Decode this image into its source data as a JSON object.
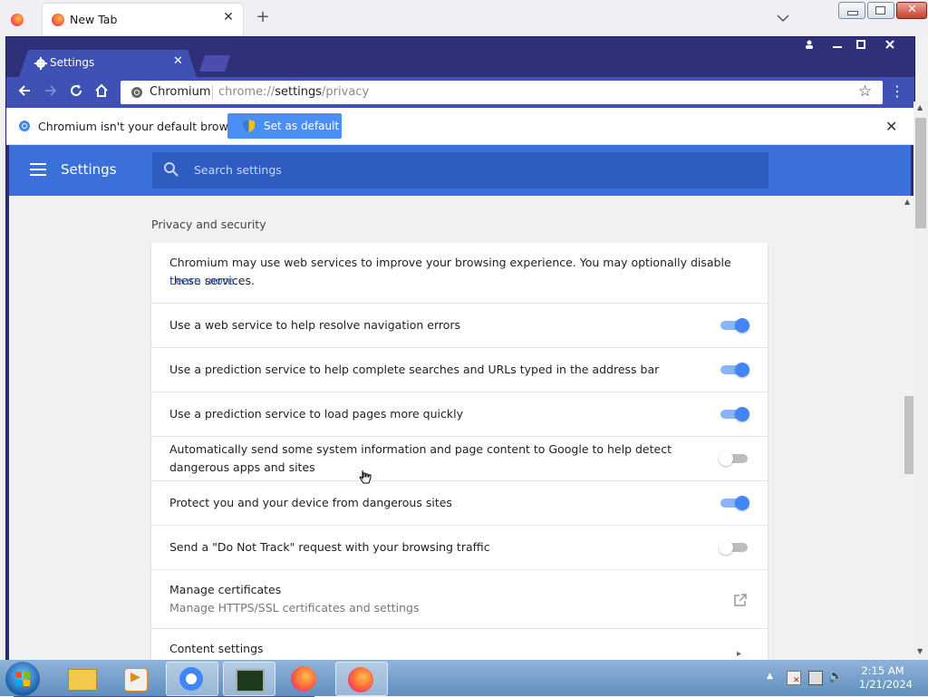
{
  "firefox": {
    "tab_title": "New Tab",
    "close_tab": "✕",
    "new_tab": "+"
  },
  "chromium": {
    "tab_title": "Settings",
    "tab_close": "✕",
    "omnibox": {
      "chip": "Chromium",
      "url_prefix": "chrome://",
      "url_host": "settings",
      "url_path": "/privacy"
    },
    "infobar": {
      "text": "Chromium isn't your default browser.",
      "button": "Set as default"
    }
  },
  "settings": {
    "title": "Settings",
    "search_placeholder": "Search settings",
    "section_title": "Privacy and security",
    "intro_text": "Chromium may use web services to improve your browsing experience. You may optionally disable these services.",
    "learn_more": "Learn more",
    "rows": [
      {
        "label": "Use a web service to help resolve navigation errors",
        "on": true
      },
      {
        "label": "Use a prediction service to help complete searches and URLs typed in the address bar",
        "on": true
      },
      {
        "label": "Use a prediction service to load pages more quickly",
        "on": true
      },
      {
        "label": "Automatically send some system information and page content to Google to help detect dangerous apps and sites",
        "on": false
      },
      {
        "label": "Protect you and your device from dangerous sites",
        "on": true
      },
      {
        "label": "Send a \"Do Not Track\" request with your browsing traffic",
        "on": false
      }
    ],
    "certificates": {
      "title": "Manage certificates",
      "subtitle": "Manage HTTPS/SSL certificates and settings"
    },
    "content_settings": "Content settings"
  },
  "taskbar": {
    "time": "2:15 AM",
    "date": "1/21/2024"
  }
}
